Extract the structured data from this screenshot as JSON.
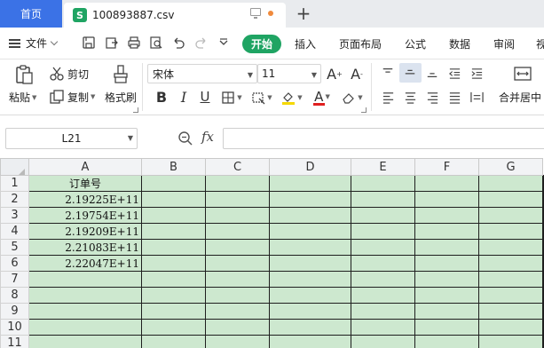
{
  "tabs": {
    "home_label": "首页",
    "file_title": "100893887.csv",
    "file_icon_letter": "S"
  },
  "menu": {
    "file_label": "文件",
    "start_label": "开始",
    "items": [
      "插入",
      "页面布局",
      "公式",
      "数据",
      "审阅",
      "视"
    ]
  },
  "ribbon": {
    "paste_label": "粘贴",
    "cut_label": "剪切",
    "copy_label": "复制",
    "format_painter_label": "格式刷",
    "font_name": "宋体",
    "font_size": "11",
    "merge_label": "合并居中"
  },
  "formula": {
    "cell_ref": "L21",
    "fx_label": "fx",
    "value": ""
  },
  "sheet": {
    "columns": [
      "A",
      "B",
      "C",
      "D",
      "E",
      "F",
      "G"
    ],
    "rows": [
      {
        "num": "1",
        "a": "订单号"
      },
      {
        "num": "2",
        "a": "2.19225E+11"
      },
      {
        "num": "3",
        "a": "2.19754E+11"
      },
      {
        "num": "4",
        "a": "2.19209E+11"
      },
      {
        "num": "5",
        "a": "2.21083E+11"
      },
      {
        "num": "6",
        "a": "2.22047E+11"
      },
      {
        "num": "7",
        "a": ""
      },
      {
        "num": "8",
        "a": ""
      },
      {
        "num": "9",
        "a": ""
      },
      {
        "num": "10",
        "a": ""
      },
      {
        "num": "11",
        "a": ""
      }
    ]
  },
  "colors": {
    "accent_blue": "#3b72e6",
    "start_green": "#1fa463",
    "cell_fill": "#cde8cf"
  }
}
